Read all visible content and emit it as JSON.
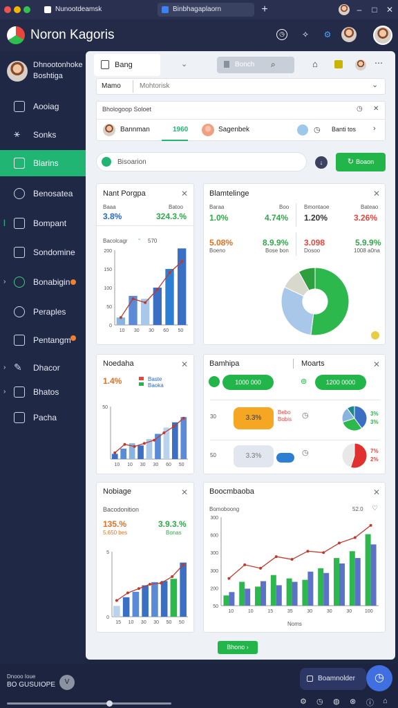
{
  "browser": {
    "tab1": "Nunootdeamsk",
    "tab2": "Binbhagaplaorn",
    "new_tab": "+",
    "win_min": "–",
    "win_max": "□",
    "win_close": "✕"
  },
  "app": {
    "title": "Noron Kagoris"
  },
  "sidebar": {
    "profile_name": "Dhnootonhoke",
    "profile_sub": "Boshtiga",
    "items": [
      {
        "label": "Aooiag"
      },
      {
        "label": "Sonks"
      },
      {
        "label": "Blarins"
      },
      {
        "label": "Benosatea"
      },
      {
        "label": "Bompant"
      },
      {
        "label": "Sondomine"
      },
      {
        "label": "Bonabigin"
      },
      {
        "label": "Peraples"
      },
      {
        "label": "Pentangm"
      },
      {
        "label": "Dhacor"
      },
      {
        "label": "Bhatos"
      },
      {
        "label": "Pacha"
      }
    ]
  },
  "toolbar": {
    "tab_label": "Bang",
    "search_label": "Bonch",
    "filter_left": "Mamo",
    "filter_right": "Mohtorisk"
  },
  "detail": {
    "header": "Bhologoop Soloet",
    "user1": "Bannman",
    "user1_value": "1960",
    "user2": "Sagenbek",
    "user3": "Banti tos",
    "search_label": "Bisoarion",
    "action_button": "Boaon"
  },
  "cards": {
    "c1": {
      "title": "Nant Porgpa",
      "lbl_a": "Baaa",
      "lbl_b": "Batoo",
      "val_a": "3.8%",
      "val_b": "324.3.%",
      "series_label": "Bacolcagr",
      "series_value": "570",
      "yticks": [
        "200",
        "150",
        "100",
        "50",
        "0"
      ],
      "xticks": [
        "10",
        "30",
        "30",
        "60",
        "50"
      ]
    },
    "c2": {
      "title": "Blamtelinge",
      "l1": "Baraa",
      "l2": "Boo",
      "l3": "Bmontaoe",
      "l4": "Bateao",
      "v1": "1.0%",
      "v2": "4.74%",
      "v3": "1.20%",
      "v4": "3.26%",
      "v5": "5.08%",
      "v6": "8.9.9%",
      "v7": "3.098",
      "v8": "5.9.9%",
      "s5": "Boeno",
      "s6": "Bose bon",
      "s7": "Dosoo",
      "s8": "1008 a0na"
    },
    "c3": {
      "title": "Noedaha",
      "value": "1.4%",
      "legend1": "Baste",
      "legend2": "Baoka",
      "ytick": "50",
      "xticks": [
        "10",
        "10",
        "30",
        "30",
        "60",
        "50"
      ]
    },
    "c4": {
      "title": "Bamhipa",
      "title2": "Moarts",
      "pill1": "1000 000",
      "pill2": "1200 0000",
      "row1_label": "30",
      "row1_value": "3.3%",
      "row1_side": "Bebo",
      "row1_side2": "Bobis",
      "row2_label": "50",
      "row2_value": "3.3%",
      "pie1_a": "3%",
      "pie1_b": "3%",
      "pie2_a": "7%",
      "pie2_b": "2%"
    },
    "c5": {
      "title": "Nobiage",
      "sub": "Bacodonition",
      "value_a": "135.%",
      "value_b": "3.9.3.%",
      "sub_a": "5.650 bes",
      "sub_b": "Bonas",
      "yticks": [
        "5",
        "0"
      ],
      "xticks": [
        "15",
        "10",
        "30",
        "30",
        "50",
        "50"
      ]
    },
    "c6": {
      "title": "Boocmbaoba",
      "sub": "Bomoboong",
      "value": "52.0",
      "yticks": [
        "300",
        "600",
        "300",
        "300",
        "200",
        "50"
      ],
      "xticks": [
        "10",
        "10",
        "15",
        "35",
        "30",
        "30",
        "30",
        "100"
      ],
      "xlabel": "Noms"
    }
  },
  "footer_button": "Bhono",
  "bottom": {
    "status_line1": "Dnooo Ioue",
    "status_line2": "BO GUSUIOPE",
    "badge": "V",
    "panel_label": "Boamnolder"
  },
  "chart_data": [
    {
      "type": "bar",
      "categories": [
        "10",
        "30",
        "30",
        "60",
        "50"
      ],
      "series": [
        {
          "values": [
            20,
            78,
            70,
            100,
            150,
            205
          ]
        }
      ],
      "trend": [
        20,
        70,
        60,
        95,
        140,
        170
      ],
      "ylim": [
        0,
        200
      ]
    },
    {
      "type": "pie",
      "values": [
        52,
        30,
        10,
        8
      ],
      "colors": [
        "#2db84e",
        "#a9c7e8",
        "#d8d8cc",
        "#2e9f3e"
      ]
    },
    {
      "type": "bar",
      "categories": [
        "10",
        "10",
        "30",
        "30",
        "60",
        "50"
      ],
      "series": [
        {
          "values": [
            10,
            20,
            30,
            26,
            38,
            48,
            60,
            70,
            80
          ]
        }
      ],
      "trend": [
        12,
        28,
        24,
        30,
        36,
        50,
        62,
        78
      ],
      "ylim": [
        0,
        100
      ]
    },
    {
      "type": "bar",
      "categories": [
        "15",
        "10",
        "30",
        "30",
        "50",
        "50"
      ],
      "series": [
        {
          "values": [
            20,
            36,
            46,
            58,
            64,
            66,
            70,
            100
          ]
        }
      ],
      "trend": [
        30,
        44,
        52,
        60,
        62,
        74,
        96
      ],
      "ylim": [
        0,
        120
      ]
    },
    {
      "type": "bar",
      "categories": [
        "10",
        "10",
        "15",
        "35",
        "30",
        "30",
        "30",
        "100"
      ],
      "series": [
        {
          "values": [
            15,
            35,
            28,
            45,
            40,
            38,
            55,
            70,
            80,
            105
          ]
        },
        {
          "values": [
            20,
            25,
            36,
            30,
            35,
            50,
            48,
            62,
            70,
            90
          ]
        }
      ],
      "trend": [
        40,
        60,
        55,
        72,
        68,
        80,
        78,
        92,
        100,
        118
      ],
      "ylim": [
        0,
        130
      ]
    }
  ]
}
